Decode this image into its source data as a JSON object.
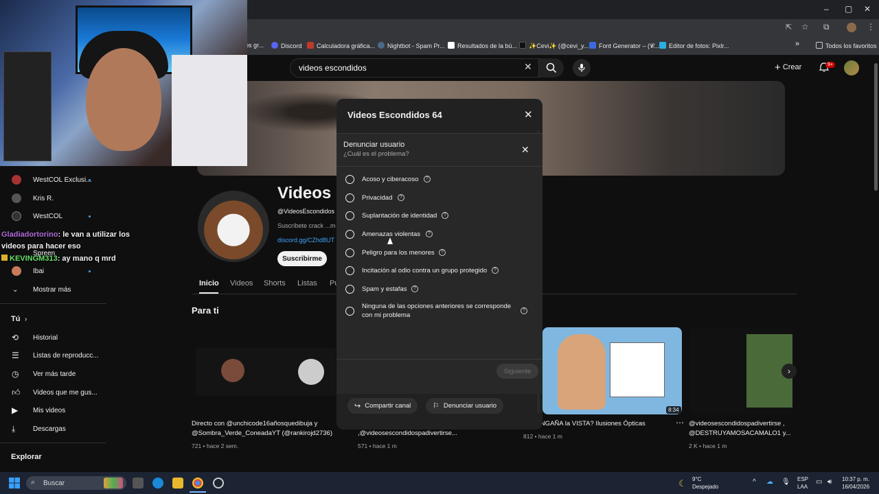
{
  "browser": {
    "bookmarks": [
      {
        "label": "os gr...",
        "color": "#888"
      },
      {
        "label": "Discord",
        "color": "#5865f2"
      },
      {
        "label": "Calculadora gráfica...",
        "color": "#c0392b"
      },
      {
        "label": "Nightbot - Spam Pr...",
        "color": "#4a6a8a"
      },
      {
        "label": "Resultados de la bú...",
        "color": "#ffffff"
      },
      {
        "label": "✨Cevi✨ (@cevi_y...",
        "color": "#111111"
      },
      {
        "label": "Font Generator – (𝓒...",
        "color": "#3a6ae0"
      },
      {
        "label": "Editor de fotos: Pixlr...",
        "color": "#2ab0e0"
      }
    ],
    "all_bookmarks": "Todos los favoritos",
    "overflow": "»"
  },
  "youtube": {
    "search_value": "videos escondidos",
    "create_label": "Crear",
    "notif_count": "9+",
    "sidebar_subs": [
      {
        "label": "WestCOL Exclusi...",
        "live": true
      },
      {
        "label": "Kris R.",
        "live": false
      },
      {
        "label": "WestCOL",
        "live": true
      },
      {
        "label": "Spreen",
        "live": true
      },
      {
        "label": "Ibai",
        "live": true
      }
    ],
    "show_more": "Mostrar más",
    "tu": "Tú",
    "tu_items": [
      "Historial",
      "Listas de reproducc...",
      "Ver más tarde",
      "Videos que me gus...",
      "Mis videos",
      "Descargas"
    ],
    "explorar": "Explorar",
    "channel": {
      "name": "Videos E",
      "handle": "@VideosEscondidos",
      "desc": "Suscríbete crack ...m",
      "link": "discord.gg/CZhd8UT",
      "subscribe": "Suscribirme"
    },
    "tabs": [
      "Inicio",
      "Videos",
      "Shorts",
      "Listas",
      "Pu"
    ],
    "section": "Para ti",
    "videos": [
      {
        "title": "Directo con @unchicode16añosquedibuja y @Sombra_Verde_ConeadaYT (@rankirojd2736)",
        "meta": "721 • hace 2 sem."
      },
      {
        "title": ",@videosescondidospadivertirse...",
        "meta": "571 • hace 1 m"
      },
      {
        "title": "o te ENGAÑA la VISTA? Ilusiones Ópticas",
        "meta": "812 • hace 1 m",
        "duration": "8:34"
      },
      {
        "title": "@videosescondidospadivertirse , @DESTRUYAMOSACAMALO1 y...",
        "meta": "2 K • hace 1 m"
      }
    ]
  },
  "stream_chat": [
    {
      "user": "Gladiadortorino",
      "user_color": "#b06ad8",
      "msg": ": le van a utilizar los videos para hacer eso"
    },
    {
      "user": "KEVINGM313",
      "user_color": "#6ae06a",
      "msg": ": ay mano q mrd"
    }
  ],
  "dialog_outer": {
    "title": "Videos Escondidos 64",
    "share": "Compartir canal",
    "report": "Denunciar usuario"
  },
  "dialog_report": {
    "title": "Denunciar usuario",
    "subtitle": "¿Cuál es el problema?",
    "options": [
      "Acoso y ciberacoso",
      "Privacidad",
      "Suplantación de identidad",
      "Amenazas violentas",
      "Peligro para los menores",
      "Incitación al odio contra un grupo protegido",
      "Spam y estafas",
      "Ninguna de las opciones anteriores se corresponde con mi problema"
    ],
    "next": "Siguiente"
  },
  "taskbar": {
    "search": "Buscar",
    "weather_temp": "9°C",
    "weather_text": "Despejado",
    "lang1": "ESP",
    "lang2": "LAA",
    "time": "10:37 p. m.",
    "date": "16/04/2026"
  }
}
